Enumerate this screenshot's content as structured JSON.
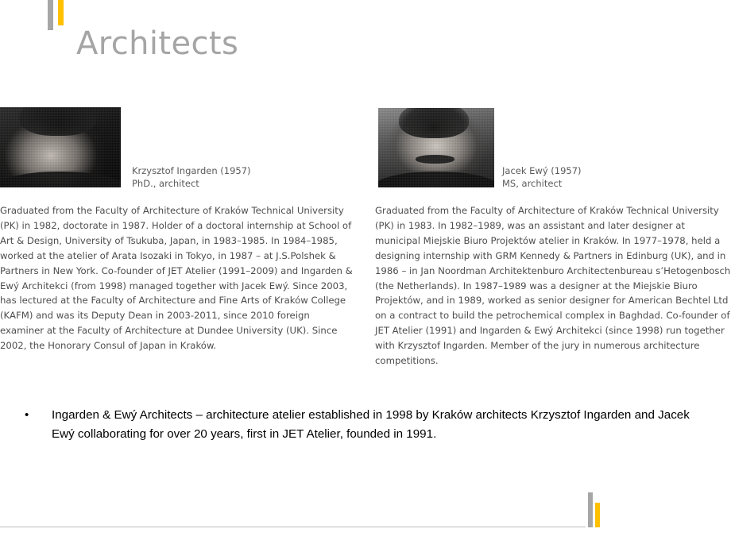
{
  "slide": {
    "title": "Architects",
    "accent_gray": "#a6a6a6",
    "accent_yellow": "#ffc000",
    "title_color": "#a5a5a5",
    "body_color": "#4d4d4d",
    "caption_color": "#5a5a5a",
    "bullet_color": "#000000",
    "rule_color": "#bfbfbf"
  },
  "profiles": [
    {
      "photo_alt": "portrait-photo-krzysztof-ingarden",
      "name": "Krzysztof Ingarden (1957)",
      "role": "PhD., architect",
      "bio": "Graduated from the Faculty of Architecture of Kraków Technical University (PK) in 1982, doctorate in 1987. Holder of a doctoral internship at School of Art & Design, University of Tsukuba, Japan, in 1983–1985. In 1984–1985, worked at the atelier of Arata Isozaki in Tokyo, in 1987 – at J.S.Polshek & Partners in New York. Co-founder of JET Atelier (1991–2009) and Ingarden & Ewý Architekci (from 1998) managed together with Jacek Ewý. Since 2003, has lectured at the Faculty of Architecture and Fine Arts of Kraków College (KAFM) and was its Deputy Dean in 2003-2011, since 2010 foreign examiner at the Faculty of Architecture at Dundee University (UK). Since 2002, the Honorary Consul of Japan in Kraków."
    },
    {
      "photo_alt": "portrait-photo-jacek-ewy",
      "name": "Jacek Ewý (1957)",
      "role": "MS, architect",
      "bio": "Graduated from the Faculty of Architecture of Kraków Technical University (PK) in 1983. In 1982–1989, was an assistant and later designer at municipal Miejskie Biuro Projektów atelier in Kraków. In 1977–1978, held a designing internship with GRM Kennedy & Partners in Edinburg (UK), and in 1986 – in Jan Noordman Architektenburo Architectenbureau s’Hetogenbosch (the Netherlands). In 1987–1989 was a designer at the Miejskie Biuro Projektów, and in 1989, worked as senior designer for American Bechtel Ltd on a contract to build the petrochemical complex in Baghdad. Co-founder of JET Atelier (1991) and Ingarden & Ewý Architekci (since 1998) run together with Krzysztof Ingarden. Member of the jury in numerous architecture competitions."
    }
  ],
  "bullet": {
    "marker": "•",
    "text": "Ingarden & Ewý Architects – architecture atelier established in 1998 by Kraków architects Krzysztof Ingarden and Jacek Ewý collaborating for over 20 years, first in JET Atelier, founded in 1991."
  }
}
